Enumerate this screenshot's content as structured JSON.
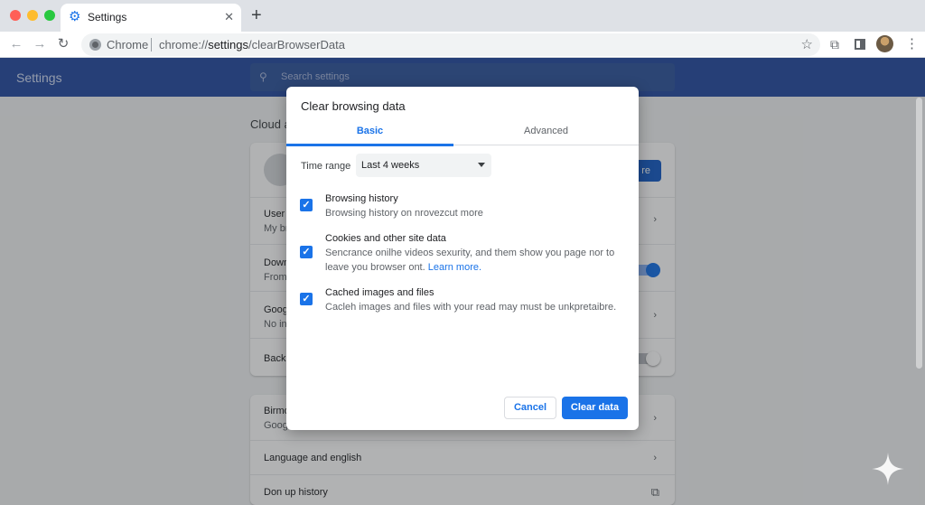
{
  "tab": {
    "title": "Settings",
    "close": "✕",
    "new_tab": "+"
  },
  "omnibox": {
    "chip": "Chrome",
    "url_prefix": "chrome://",
    "url_host": "settings",
    "url_path": "/clearBrowserData"
  },
  "icons": {
    "back": "←",
    "forward": "→",
    "reload": "↻",
    "star": "☆",
    "extensions": "⧉",
    "menu": "⋮",
    "search": "🔍"
  },
  "page": {
    "title": "Settings",
    "search_placeholder": "Search settings",
    "section_title": "Cloud a",
    "card1_rows": [
      {
        "title": "",
        "sub": ""
      },
      {
        "title": "User",
        "sub": "My br"
      },
      {
        "title": "Down",
        "sub": "From"
      },
      {
        "title": "Goog",
        "sub": "No in"
      },
      {
        "title": "Back",
        "sub": ""
      }
    ],
    "sync_button": "re",
    "card2_rows": [
      {
        "title": "Birmo",
        "sub": "Goog"
      },
      {
        "title": "Language and english",
        "sub": ""
      },
      {
        "title": "Don up history",
        "sub": ""
      }
    ],
    "arrow": "›",
    "external": "⧉"
  },
  "dialog": {
    "title": "Clear browsing data",
    "tabs": [
      "Basic",
      "Advanced"
    ],
    "time_range_label": "Time range",
    "time_range_value": "Last 4 weeks",
    "options": [
      {
        "title": "Browsing history",
        "desc": "Browsing history on nrovezcut more",
        "checked": true
      },
      {
        "title": "Cookies and other site data",
        "desc": "Sencrance onilhe videos sexurity, and them show you page nor to leave you browser ont.",
        "link": "Learn more.",
        "checked": true
      },
      {
        "title": "Cached images and files",
        "desc": "Cacleh images and files with your read may must be unkpretaibre.",
        "checked": true
      }
    ],
    "check_glyph": "✓",
    "cancel": "Cancel",
    "clear": "Clear data"
  },
  "colors": {
    "accent": "#1a73e8",
    "header": "#2a4fa3"
  }
}
